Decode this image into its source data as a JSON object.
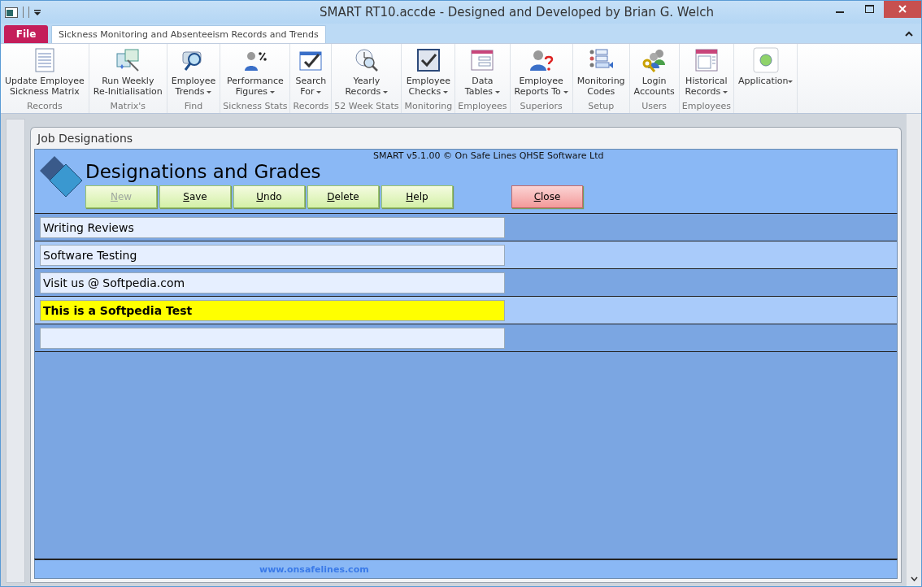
{
  "window": {
    "title": "SMART RT10.accde - Designed and Developed by Brian G. Welch"
  },
  "file_tab": {
    "label": "File"
  },
  "ribbon_tabs": [
    {
      "label": "Sickness Monitoring and Absenteeism Records and Trends",
      "selected": true
    }
  ],
  "ribbon_groups": [
    {
      "button": "Update Employee\nSickness Matrix",
      "dropdown": false,
      "group": "Records"
    },
    {
      "button": "Run Weekly\nRe-Initialisation",
      "dropdown": false,
      "group": "Matrix's"
    },
    {
      "button": "Employee\nTrends",
      "dropdown": true,
      "group": "Find"
    },
    {
      "button": "Performance\nFigures",
      "dropdown": true,
      "group": "Sickness Stats"
    },
    {
      "button": "Search\nFor",
      "dropdown": true,
      "group": "Records"
    },
    {
      "button": "Yearly\nRecords",
      "dropdown": true,
      "group": "52 Week Stats"
    },
    {
      "button": "Employee\nChecks",
      "dropdown": true,
      "group": "Monitoring"
    },
    {
      "button": "Data\nTables",
      "dropdown": true,
      "group": "Employees"
    },
    {
      "button": "Employee\nReports To",
      "dropdown": true,
      "group": "Superiors"
    },
    {
      "button": "Monitoring\nCodes",
      "dropdown": false,
      "group": "Setup"
    },
    {
      "button": "Login\nAccounts",
      "dropdown": false,
      "group": "Users"
    },
    {
      "button": "Historical\nRecords",
      "dropdown": true,
      "group": "Employees"
    },
    {
      "button": "Application",
      "dropdown": true
    }
  ],
  "form": {
    "tab": "Job Designations",
    "copyright": "SMART v5.1.00 © On Safe Lines QHSE Software Ltd",
    "heading": "Designations and Grades",
    "buttons": [
      {
        "label": "New",
        "kind": "normal",
        "disabled": true
      },
      {
        "label": "Save",
        "kind": "normal",
        "disabled": false
      },
      {
        "label": "Undo",
        "kind": "normal",
        "disabled": false
      },
      {
        "label": "Delete",
        "kind": "normal",
        "disabled": false
      },
      {
        "label": "Help",
        "kind": "normal",
        "disabled": false
      },
      {
        "label": "Close",
        "kind": "close",
        "disabled": false
      }
    ],
    "records": [
      {
        "value": "Writing Reviews",
        "selected": false
      },
      {
        "value": "Software Testing",
        "selected": false
      },
      {
        "value": "Visit us @ Softpedia.com",
        "selected": false
      },
      {
        "value": "This is a Softpedia Test",
        "selected": true
      },
      {
        "selected": false
      }
    ],
    "footer_link": "www.onsafelines.com"
  }
}
